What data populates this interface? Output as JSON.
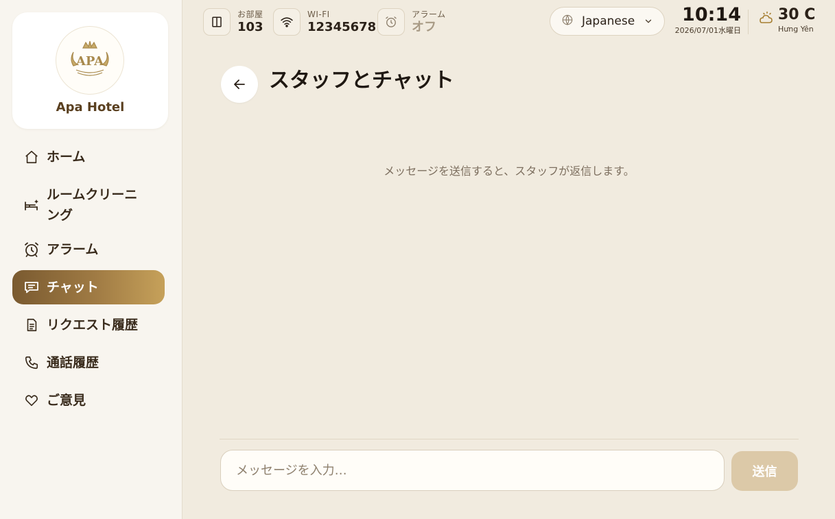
{
  "sidebar": {
    "hotel_name": "Apa Hotel",
    "logo_text": "APA",
    "items": [
      {
        "label": "ホーム",
        "icon": "home-icon"
      },
      {
        "label": "ルームクリーニング",
        "icon": "bed-cleaning-icon"
      },
      {
        "label": "アラーム",
        "icon": "alarm-icon"
      },
      {
        "label": "チャット",
        "icon": "chat-icon",
        "active": true
      },
      {
        "label": "リクエスト履歴",
        "icon": "document-icon"
      },
      {
        "label": "通話履歴",
        "icon": "phone-icon"
      },
      {
        "label": "ご意見",
        "icon": "heart-icon"
      }
    ]
  },
  "topbar": {
    "room": {
      "label": "お部屋",
      "value": "103",
      "icon": "door-icon"
    },
    "wifi": {
      "label": "WI-FI",
      "value": "12345678",
      "icon": "wifi-icon"
    },
    "alarm": {
      "label": "アラーム",
      "value": "オフ",
      "icon": "alarm-icon"
    },
    "language": {
      "value": "Japanese",
      "icon": "globe-icon"
    },
    "clock": {
      "time": "10:14",
      "date": "2026/07/01水曜日"
    },
    "weather": {
      "temp": "30 C",
      "location": "Hưng Yên",
      "icon": "partly-cloudy-icon"
    }
  },
  "page": {
    "title": "スタッフとチャット",
    "empty_message": "メッセージを送信すると、スタッフが返信します。"
  },
  "composer": {
    "placeholder": "メッセージを入力…",
    "send_label": "送信"
  },
  "colors": {
    "accent_gradient_start": "#7a5a30",
    "accent_gradient_end": "#c6a15a",
    "background": "#f1ebdf",
    "send_button": "#dcc9a8"
  }
}
